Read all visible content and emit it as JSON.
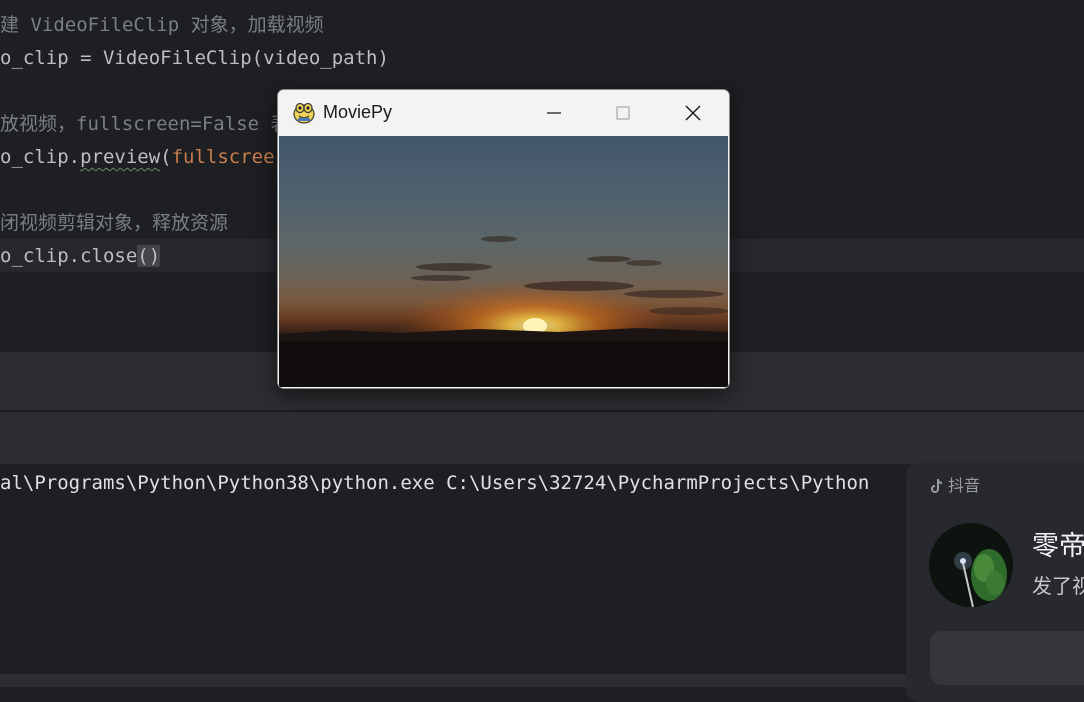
{
  "editor": {
    "lines": [
      {
        "comment": "建 VideoFileClip 对象，加载视频"
      },
      {
        "code": "o_clip = VideoFileClip(video_path)"
      },
      {
        "comment": "放视频，fullscreen=False 表"
      },
      {
        "prefix": "o_clip.",
        "func": "preview",
        "paren": "(",
        "kwarg": "fullscree"
      },
      {
        "comment": "闭视频剪辑对象，释放资源"
      },
      {
        "prefix": "o_clip.close",
        "paren_hl": "()"
      }
    ]
  },
  "console": {
    "command": "al\\Programs\\Python\\Python38\\python.exe C:\\Users\\32724\\PycharmProjects\\Python"
  },
  "moviepy_window": {
    "title": "MoviePy",
    "icons": {
      "app": "pygame-snake-icon",
      "minimize": "minimize-icon",
      "maximize": "maximize-icon",
      "close": "close-icon"
    }
  },
  "notification": {
    "app_name": "抖音",
    "app_icon": "douyin-logo-icon",
    "title": "零帝",
    "subtitle": "发了视"
  },
  "colors": {
    "editor_bg": "#1e1f22",
    "panel_bg": "#2b2d30",
    "comment": "#7a7e85",
    "keyword_arg": "#c77d4a",
    "notification_bg": "#28292e"
  }
}
